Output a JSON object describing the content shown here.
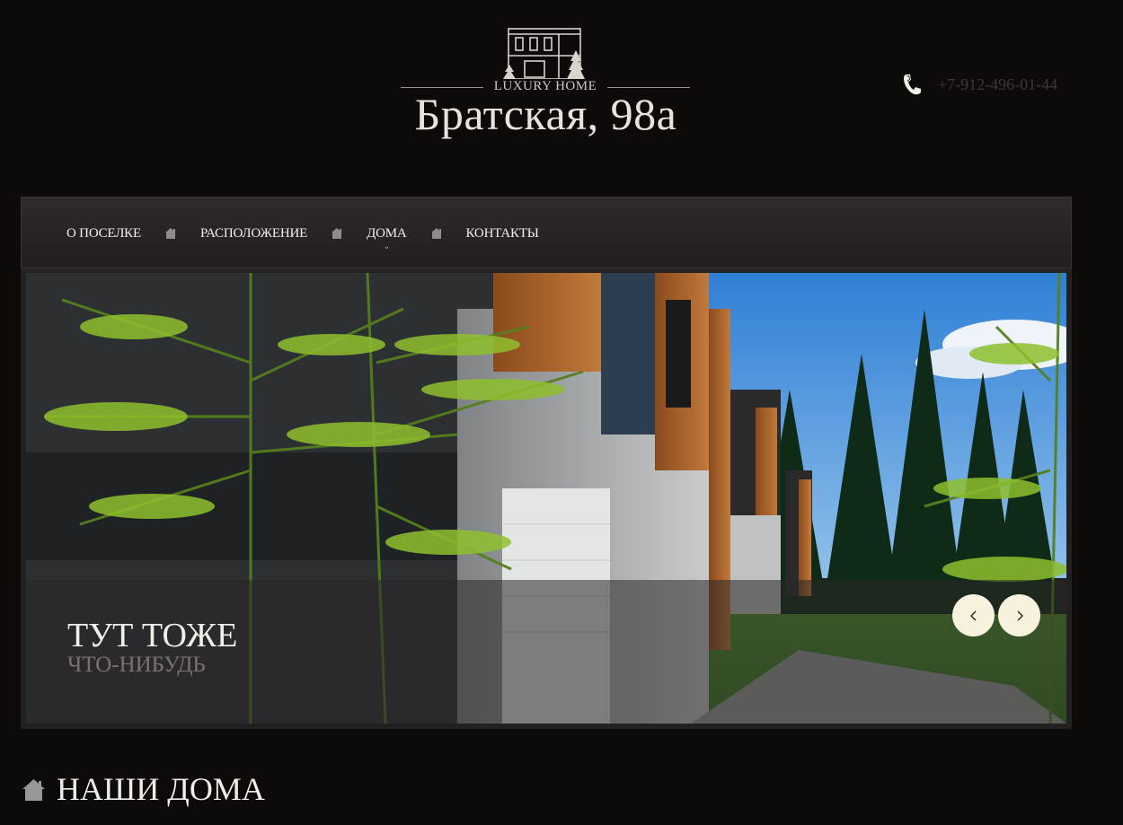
{
  "header": {
    "tagline": "LUXURY HOME",
    "site_name": "Братская, 98а",
    "phone": "+7-912-496-01-44",
    "phone_icon": "phone-icon",
    "logo_icon": "house-logo-icon"
  },
  "nav": {
    "items": [
      {
        "label": "О ПОСЕЛКЕ"
      },
      {
        "label": "РАСПОЛОЖЕНИЕ"
      },
      {
        "label": "ДОМА",
        "has_dropdown": true
      },
      {
        "label": "КОНТАКТЫ"
      }
    ],
    "caret": "⌄",
    "separator_icon": "house-separator-icon"
  },
  "slider": {
    "caption_title": "ТУТ ТОЖЕ",
    "caption_sub": "ЧТО-НИБУДЬ",
    "prev_icon": "chevron-left-icon",
    "next_icon": "chevron-right-icon"
  },
  "section": {
    "title": "НАШИ ДОМА",
    "icon": "home-icon"
  },
  "colors": {
    "background": "#0f0a0a",
    "nav_bg": "#2a2526",
    "arrow_bg": "#f7f2de",
    "caption_sub": "#7e6f73"
  }
}
